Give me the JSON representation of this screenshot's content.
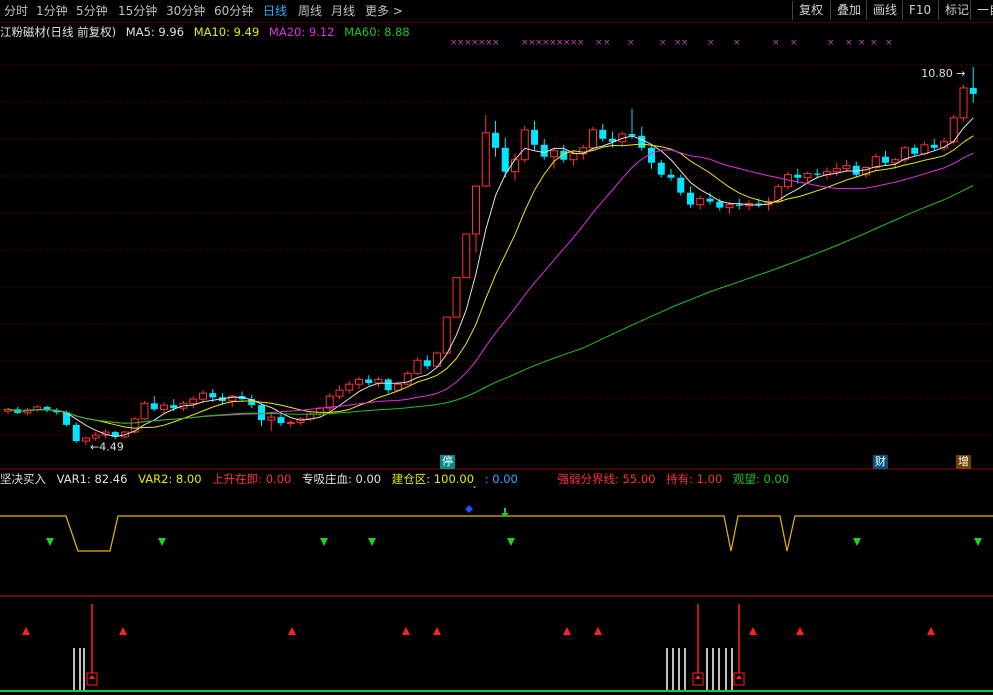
{
  "periods": [
    "分时",
    "1分钟",
    "5分钟",
    "15分钟",
    "30分钟",
    "60分钟",
    "日线",
    "周线",
    "月线",
    "更多 >"
  ],
  "active_period": "日线",
  "toolbar": {
    "fq": "复权",
    "overlay": "叠加",
    "draw": "画线",
    "f10": "F10",
    "mark": "标记",
    "auto": "一自"
  },
  "stock_title": "江粉磁材(日线 前复权)",
  "ma": {
    "ma5": {
      "label": "MA5: 9.96",
      "color": "#e0e0e0"
    },
    "ma10": {
      "label": "MA10: 9.49",
      "color": "#e8e800"
    },
    "ma20": {
      "label": "MA20: 9.12",
      "color": "#e030e0"
    },
    "ma60": {
      "label": "MA60: 8.88",
      "color": "#20c020"
    }
  },
  "annotations": {
    "high": "10.80",
    "low": "4.49"
  },
  "event_flags": {
    "limit": "停",
    "fin": "财",
    "add": "增"
  },
  "indicator": {
    "name": "坚决买入",
    "var1": "VAR1: 82.46",
    "var2": "VAR2: 8.00",
    "up": "上升在即: 0.00",
    "blood": "专吸庄血: 0.00",
    "build": "建仓区: 100.00",
    "val": ": 0.00",
    "line": "强弱分界线: 55.00",
    "hold": "持有: 1.00",
    "watch": "观望: 0.00"
  },
  "colors": {
    "up": "#ff3030",
    "down": "#00e5ff",
    "grid": "#5a0000",
    "axis": "#8b0000"
  },
  "chart_data": {
    "type": "candlestick",
    "ohlc": [
      [
        5.05,
        5.1,
        5.0,
        5.08
      ],
      [
        5.08,
        5.12,
        5.0,
        5.02
      ],
      [
        5.02,
        5.1,
        4.98,
        5.07
      ],
      [
        5.07,
        5.15,
        5.04,
        5.12
      ],
      [
        5.12,
        5.14,
        5.03,
        5.06
      ],
      [
        5.06,
        5.1,
        4.99,
        5.03
      ],
      [
        5.03,
        5.06,
        4.8,
        4.82
      ],
      [
        4.82,
        4.86,
        4.52,
        4.55
      ],
      [
        4.55,
        4.62,
        4.49,
        4.6
      ],
      [
        4.6,
        4.7,
        4.55,
        4.65
      ],
      [
        4.65,
        4.75,
        4.6,
        4.7
      ],
      [
        4.7,
        4.72,
        4.58,
        4.62
      ],
      [
        4.62,
        4.72,
        4.58,
        4.7
      ],
      [
        4.7,
        4.95,
        4.68,
        4.92
      ],
      [
        4.92,
        5.22,
        4.9,
        5.18
      ],
      [
        5.18,
        5.3,
        5.05,
        5.08
      ],
      [
        5.08,
        5.2,
        5.0,
        5.15
      ],
      [
        5.15,
        5.25,
        5.05,
        5.1
      ],
      [
        5.1,
        5.22,
        5.05,
        5.18
      ],
      [
        5.18,
        5.3,
        5.1,
        5.25
      ],
      [
        5.25,
        5.4,
        5.18,
        5.35
      ],
      [
        5.35,
        5.42,
        5.2,
        5.28
      ],
      [
        5.28,
        5.35,
        5.15,
        5.22
      ],
      [
        5.22,
        5.32,
        5.12,
        5.3
      ],
      [
        5.3,
        5.38,
        5.22,
        5.25
      ],
      [
        5.25,
        5.32,
        5.1,
        5.15
      ],
      [
        5.15,
        5.18,
        4.8,
        4.9
      ],
      [
        4.9,
        5.02,
        4.72,
        4.95
      ],
      [
        4.95,
        5.0,
        4.8,
        4.85
      ],
      [
        4.85,
        4.9,
        4.78,
        4.86
      ],
      [
        4.86,
        4.95,
        4.82,
        4.92
      ],
      [
        4.92,
        5.05,
        4.88,
        5.0
      ],
      [
        5.0,
        5.12,
        4.95,
        5.1
      ],
      [
        5.1,
        5.35,
        5.05,
        5.3
      ],
      [
        5.3,
        5.48,
        5.25,
        5.4
      ],
      [
        5.4,
        5.55,
        5.35,
        5.5
      ],
      [
        5.5,
        5.62,
        5.42,
        5.58
      ],
      [
        5.58,
        5.65,
        5.48,
        5.52
      ],
      [
        5.52,
        5.62,
        5.45,
        5.58
      ],
      [
        5.58,
        5.6,
        5.35,
        5.4
      ],
      [
        5.4,
        5.55,
        5.38,
        5.5
      ],
      [
        5.5,
        5.72,
        5.48,
        5.68
      ],
      [
        5.68,
        5.95,
        5.65,
        5.9
      ],
      [
        5.9,
        5.98,
        5.75,
        5.8
      ],
      [
        5.8,
        6.05,
        5.78,
        6.02
      ],
      [
        6.02,
        6.62,
        6.02,
        6.62
      ],
      [
        6.62,
        7.28,
        6.62,
        7.28
      ],
      [
        7.28,
        8.01,
        7.28,
        8.01
      ],
      [
        8.01,
        8.81,
        7.7,
        8.81
      ],
      [
        8.81,
        10.0,
        8.8,
        9.7
      ],
      [
        9.7,
        9.9,
        9.3,
        9.45
      ],
      [
        9.45,
        9.62,
        8.95,
        9.05
      ],
      [
        9.05,
        9.35,
        8.9,
        9.25
      ],
      [
        9.25,
        9.82,
        9.2,
        9.75
      ],
      [
        9.75,
        9.9,
        9.4,
        9.5
      ],
      [
        9.5,
        9.6,
        9.25,
        9.3
      ],
      [
        9.3,
        9.45,
        9.1,
        9.4
      ],
      [
        9.4,
        9.5,
        9.2,
        9.25
      ],
      [
        9.25,
        9.4,
        9.15,
        9.35
      ],
      [
        9.35,
        9.5,
        9.25,
        9.45
      ],
      [
        9.45,
        9.8,
        9.4,
        9.75
      ],
      [
        9.75,
        9.85,
        9.55,
        9.6
      ],
      [
        9.6,
        9.72,
        9.45,
        9.55
      ],
      [
        9.55,
        9.72,
        9.48,
        9.68
      ],
      [
        9.68,
        10.1,
        9.6,
        9.65
      ],
      [
        9.65,
        9.8,
        9.4,
        9.45
      ],
      [
        9.45,
        9.5,
        9.1,
        9.2
      ],
      [
        9.2,
        9.25,
        8.95,
        9.0
      ],
      [
        9.0,
        9.1,
        8.9,
        8.95
      ],
      [
        8.95,
        9.0,
        8.65,
        8.7
      ],
      [
        8.7,
        8.8,
        8.45,
        8.5
      ],
      [
        8.5,
        8.65,
        8.42,
        8.6
      ],
      [
        8.6,
        8.7,
        8.5,
        8.55
      ],
      [
        8.55,
        8.6,
        8.4,
        8.45
      ],
      [
        8.45,
        8.55,
        8.35,
        8.5
      ],
      [
        8.5,
        8.6,
        8.42,
        8.48
      ],
      [
        8.48,
        8.58,
        8.4,
        8.52
      ],
      [
        8.52,
        8.6,
        8.45,
        8.5
      ],
      [
        8.5,
        8.62,
        8.4,
        8.55
      ],
      [
        8.55,
        8.85,
        8.52,
        8.8
      ],
      [
        8.8,
        9.05,
        8.75,
        9.0
      ],
      [
        9.0,
        9.1,
        8.85,
        8.95
      ],
      [
        8.95,
        9.05,
        8.88,
        9.02
      ],
      [
        9.02,
        9.1,
        8.95,
        9.0
      ],
      [
        9.0,
        9.12,
        8.92,
        9.05
      ],
      [
        9.05,
        9.2,
        8.98,
        9.1
      ],
      [
        9.1,
        9.25,
        9.05,
        9.15
      ],
      [
        9.15,
        9.22,
        8.95,
        9.0
      ],
      [
        9.0,
        9.15,
        8.95,
        9.12
      ],
      [
        9.12,
        9.35,
        9.08,
        9.3
      ],
      [
        9.3,
        9.4,
        9.15,
        9.2
      ],
      [
        9.2,
        9.28,
        9.1,
        9.25
      ],
      [
        9.25,
        9.48,
        9.2,
        9.45
      ],
      [
        9.45,
        9.5,
        9.3,
        9.35
      ],
      [
        9.35,
        9.55,
        9.32,
        9.5
      ],
      [
        9.5,
        9.6,
        9.4,
        9.45
      ],
      [
        9.45,
        9.62,
        9.4,
        9.55
      ],
      [
        9.55,
        10.0,
        9.5,
        9.95
      ],
      [
        9.95,
        10.5,
        9.9,
        10.45
      ],
      [
        10.45,
        10.8,
        10.2,
        10.35
      ]
    ],
    "price_range": [
      4.3,
      10.95
    ],
    "ma_periods": [
      5,
      10,
      20,
      60
    ]
  }
}
